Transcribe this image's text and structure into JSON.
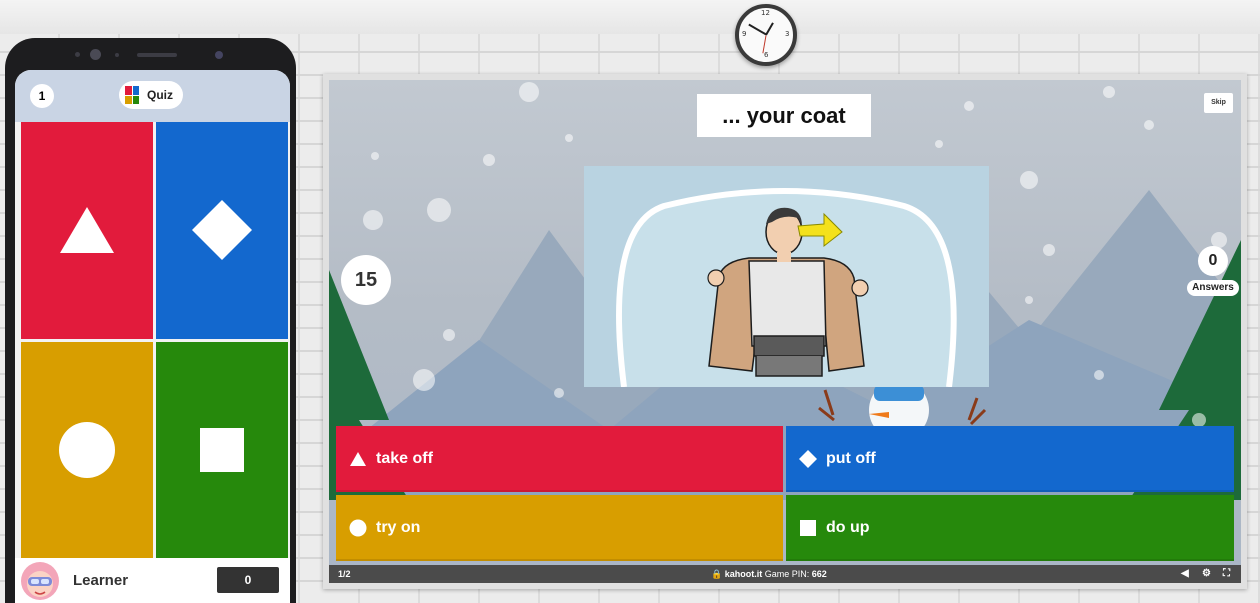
{
  "phone": {
    "question_number": "1",
    "quiz_label": "Quiz",
    "player_name": "Learner",
    "score": "0",
    "tiles": [
      {
        "shape": "triangle-icon",
        "color": "#e21b3c"
      },
      {
        "shape": "diamond-icon",
        "color": "#1368ce"
      },
      {
        "shape": "circle-icon",
        "color": "#d89e00"
      },
      {
        "shape": "square-icon",
        "color": "#26890c"
      }
    ]
  },
  "game": {
    "question": "... your coat",
    "skip_label": "Skip",
    "timer": "15",
    "answers_count": "0",
    "answers_label": "Answers",
    "answers": [
      {
        "label": "take off",
        "shape": "triangle-icon",
        "color": "#e21b3c"
      },
      {
        "label": "put off",
        "shape": "diamond-icon",
        "color": "#1368ce"
      },
      {
        "label": "try on",
        "shape": "circle-icon",
        "color": "#d89e00"
      },
      {
        "label": "do up",
        "shape": "square-icon",
        "color": "#26890c"
      }
    ],
    "status": {
      "page": "1/2",
      "site": "kahoot.it",
      "pin_label": "Game PIN:",
      "pin": "662"
    }
  }
}
